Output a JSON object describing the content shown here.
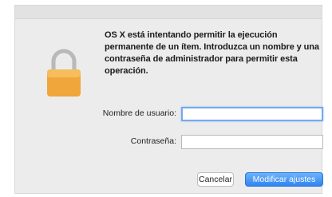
{
  "dialog": {
    "message": "OS X está intentando permitir la ejecución permanente de un ítem. Introduzca un nombre y una contraseña de administrador para permitir esta operación.",
    "username_label": "Nombre de usuario:",
    "username_value": "",
    "password_label": "Contraseña:",
    "password_value": "",
    "cancel_label": "Cancelar",
    "confirm_label": "Modificar ajustes"
  },
  "icons": {
    "lock": "lock-icon"
  },
  "colors": {
    "lock_body": "#f0a63a",
    "lock_shackle": "#b8b8b8",
    "primary_button": "#3b8ef5",
    "focus_ring": "#74a9f0"
  }
}
